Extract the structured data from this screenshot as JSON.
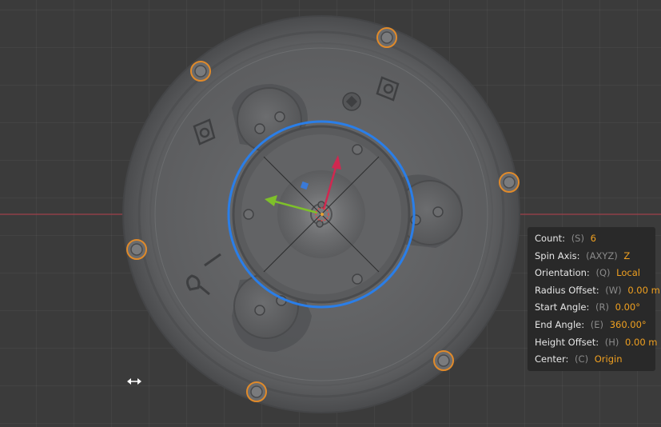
{
  "viewport": {
    "background": "#3b3b3b",
    "axis_x_color": "#a0404a",
    "selection_color": "#e08a2a",
    "gizmo_ring_color": "#2a7ee8"
  },
  "gizmo": {
    "x_axis_color": "#7ec02a",
    "y_axis_color": "#d02850",
    "z_handle_color": "#3a7ad8"
  },
  "operator_panel": {
    "rows": [
      {
        "label": "Count:",
        "key": "(S)",
        "value": "6"
      },
      {
        "label": "Spin Axis:",
        "key": "(AXYZ)",
        "value": "Z"
      },
      {
        "label": "Orientation:",
        "key": "(Q)",
        "value": "Local"
      },
      {
        "label": "Radius Offset:",
        "key": "(W)",
        "value": "0.00 m"
      },
      {
        "label": "Start Angle:",
        "key": "(R)",
        "value": "0.00°"
      },
      {
        "label": "End Angle:",
        "key": "(E)",
        "value": "360.00°"
      },
      {
        "label": "Height Offset:",
        "key": "(H)",
        "value": "0.00 m"
      },
      {
        "label": "Center:",
        "key": "(C)",
        "value": "Origin"
      }
    ]
  },
  "cursor": {
    "icon": "horizontal-resize-cursor-icon"
  }
}
